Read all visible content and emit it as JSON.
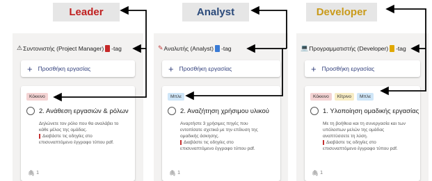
{
  "roles": [
    {
      "label": "Leader",
      "color": "#c02020"
    },
    {
      "label": "Analyst",
      "color": "#2b4a7a"
    },
    {
      "label": "Developer",
      "color": "#c99a1a"
    }
  ],
  "columns": [
    {
      "header_icon": "warning-icon",
      "header_prefix": "Συντονιστής (Project Manager)",
      "tag_color": "#c62828",
      "tag_suffix": "-tag",
      "add_label": "Προσθήκη εργασίας",
      "chips": [
        {
          "label": "Κόκκινο",
          "bg": "#f4d3d3"
        }
      ],
      "task_title": "2. Ανάθεση εργασιών & ρόλων",
      "desc_lines": [
        "Δηλώνετε τον ρόλο που θα αναλάβει το",
        "κάθε μέλος της ομάδας."
      ],
      "note_lines": [
        "Διαβάστε τις οδηγίες στο",
        "επισυναπτόμενο έγγραφο τύπου pdf."
      ],
      "attach_count": "1"
    },
    {
      "header_icon": "pencil-icon",
      "header_prefix": "Αναλυτής (Analyst)",
      "tag_color": "#3a7bd5",
      "tag_suffix": "-tag",
      "add_label": "Προσθήκη εργασίας",
      "chips": [
        {
          "label": "Μπλε",
          "bg": "#cfe6f8"
        }
      ],
      "task_title": "2. Αναζήτηση χρήσιμου υλικού",
      "desc_lines": [
        "Αναρτήστε 3 χρήσιμες πηγές που",
        "εντοπίσατε σχετικά με την επίλυση της",
        "ομαδικής άσκησης."
      ],
      "note_lines": [
        "Διαβάστε τις οδηγίες στο",
        "επισυναπτόμενο έγγραφο τύπου pdf."
      ],
      "attach_count": "1"
    },
    {
      "header_icon": "laptop-icon",
      "header_prefix": "Προγραμματιστής (Developer)",
      "tag_color": "#e0a800",
      "tag_suffix": "-tag",
      "add_label": "Προσθήκη εργασίας",
      "chips": [
        {
          "label": "Κόκκινο",
          "bg": "#f4d3d3"
        },
        {
          "label": "Κίτρινο",
          "bg": "#f7ecc4"
        },
        {
          "label": "Μπλε",
          "bg": "#cfe6f8"
        }
      ],
      "task_title": "1. Υλοποίηση ομαδικής εργασίας",
      "desc_lines": [
        "Με τη βοήθεια και τη συνεργασία και των",
        "υπόλοιπων μελών της ομάδας",
        "αναπτύσσετε τη λύση."
      ],
      "note_lines": [
        "Διαβάστε τις οδηγίες στο",
        "επισυναπτόμενο έγγραφο τύπου pdf."
      ],
      "attach_count": "1"
    }
  ]
}
